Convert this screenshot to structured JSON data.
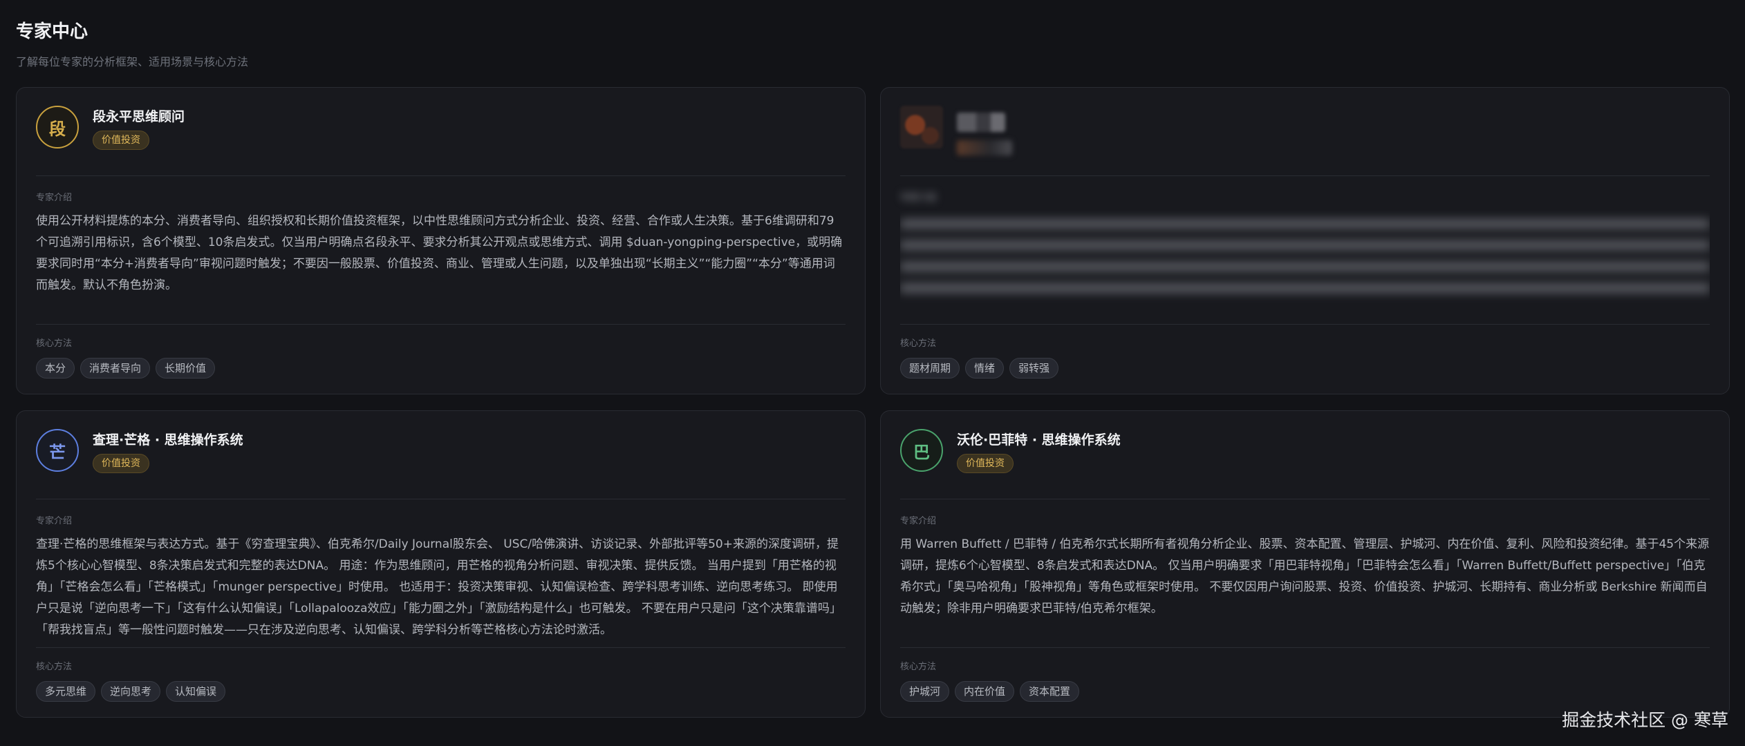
{
  "header": {
    "title": "专家中心",
    "subtitle": "了解每位专家的分析框架、适用场景与核心方法"
  },
  "labels": {
    "intro": "专家介绍",
    "methods": "核心方法"
  },
  "experts": [
    {
      "avatar": "段",
      "name": "段永平思维顾问",
      "tag": "价值投资",
      "intro": "使用公开材料提炼的本分、消费者导向、组织授权和长期价值投资框架，以中性思维顾问方式分析企业、投资、经营、合作或人生决策。基于6维调研和79个可追溯引用标识，含6个模型、10条启发式。仅当用户明确点名段永平、要求分析其公开观点或思维方式、调用 $duan-yongping-perspective，或明确要求同时用“本分+消费者导向”审视问题时触发；不要因一般股票、价值投资、商业、管理或人生问题，以及单独出现“长期主义”“能力圈”“本分”等通用词而触发。默认不角色扮演。",
      "methods": [
        "本分",
        "消费者导向",
        "长期价值"
      ]
    },
    {
      "avatar": "",
      "name": "",
      "tag": "",
      "intro": "",
      "methods": [
        "题材周期",
        "情绪",
        "弱转强"
      ]
    },
    {
      "avatar": "芒",
      "name": "查理·芒格 · 思维操作系统",
      "tag": "价值投资",
      "intro": "查理·芒格的思维框架与表达方式。基于《穷查理宝典》、伯克希尔/Daily Journal股东会、 USC/哈佛演讲、访谈记录、外部批评等50+来源的深度调研，提炼5个核心心智模型、8条决策启发式和完整的表达DNA。 用途：作为思维顾问，用芒格的视角分析问题、审视决策、提供反馈。 当用户提到「用芒格的视角」「芒格会怎么看」「芒格模式」「munger perspective」时使用。 也适用于：投资决策审视、认知偏误检查、跨学科思考训练、逆向思考练习。 即使用户只是说「逆向思考一下」「这有什么认知偏误」「Lollapalooza效应」「能力圈之外」「激励结构是什么」也可触发。 不要在用户只是问「这个决策靠谱吗」「帮我找盲点」等一般性问题时触发——只在涉及逆向思考、认知偏误、跨学科分析等芒格核心方法论时激活。",
      "methods": [
        "多元思维",
        "逆向思考",
        "认知偏误"
      ]
    },
    {
      "avatar": "巴",
      "name": "沃伦·巴菲特 · 思维操作系统",
      "tag": "价值投资",
      "intro": "用 Warren Buffett / 巴菲特 / 伯克希尔式长期所有者视角分析企业、股票、资本配置、管理层、护城河、内在价值、复利、风险和投资纪律。基于45个来源调研，提炼6个心智模型、8条启发式和表达DNA。 仅当用户明确要求「用巴菲特视角」「巴菲特会怎么看」「Warren Buffett/Buffett perspective」「伯克希尔式」「奥马哈视角」「股神视角」等角色或框架时使用。 不要仅因用户询问股票、投资、价值投资、护城河、长期持有、商业分析或 Berkshire 新闻而自动触发；除非用户明确要求巴菲特/伯克希尔框架。",
      "methods": [
        "护城河",
        "内在价值",
        "资本配置"
      ]
    }
  ],
  "watermark": "掘金技术社区 @ 寒草"
}
